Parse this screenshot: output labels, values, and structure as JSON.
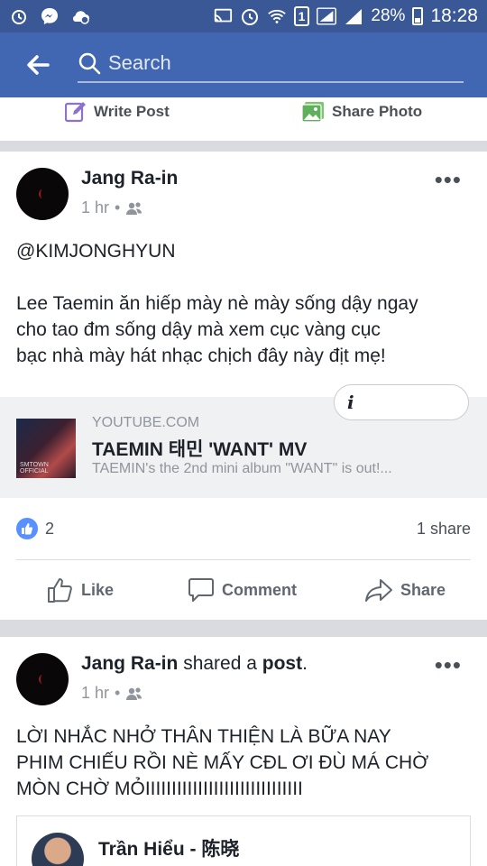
{
  "status_bar": {
    "battery": "28%",
    "time": "18:28",
    "sim": "1"
  },
  "header": {
    "search_placeholder": "Search"
  },
  "composer": {
    "write_post": "Write Post",
    "share_photo": "Share Photo"
  },
  "post1": {
    "author": "Jang Ra-in",
    "time": "1 hr",
    "separator": "•",
    "mention": "@KIMJONGHYUN",
    "lines": [
      "Lee Taemin ăn hiếp mày nè mày sống dậy ngay",
      "cho tao đm sống dậy mà xem cục vàng cục",
      "bạc nhà mày hát nhạc chịch đây này địt mẹ!"
    ],
    "link": {
      "domain": "YOUTUBE.COM",
      "title": "TAEMIN 태민 'WANT' MV",
      "description": "TAEMIN's the 2nd mini album \"WANT\" is out!...",
      "thumb_label": "SMTOWN OFFICIAL",
      "info": "i"
    },
    "like_count": "2",
    "share_count": "1 share",
    "actions": {
      "like": "Like",
      "comment": "Comment",
      "share": "Share"
    }
  },
  "post2": {
    "author": "Jang Ra-in",
    "shared_text": "shared a",
    "post_word": "post",
    "period": ".",
    "time": "1 hr",
    "separator": "•",
    "lines": [
      "LỜI NHẮC NHỞ THÂN THIỆN LÀ BỮA NAY",
      "PHIM CHIẾU RỒI NÈ MẤY CĐL ƠI ĐÙ MÁ CHỜ",
      "MÒN CHỜ MỎIIIIIIIIIIIIIIIIIIIIIIIIIIIIII"
    ],
    "shared_author": "Trần Hiểu - 陈晓"
  },
  "colors": {
    "header": "#4267b2",
    "status": "#3a5895",
    "like_blue": "#5890ff"
  }
}
